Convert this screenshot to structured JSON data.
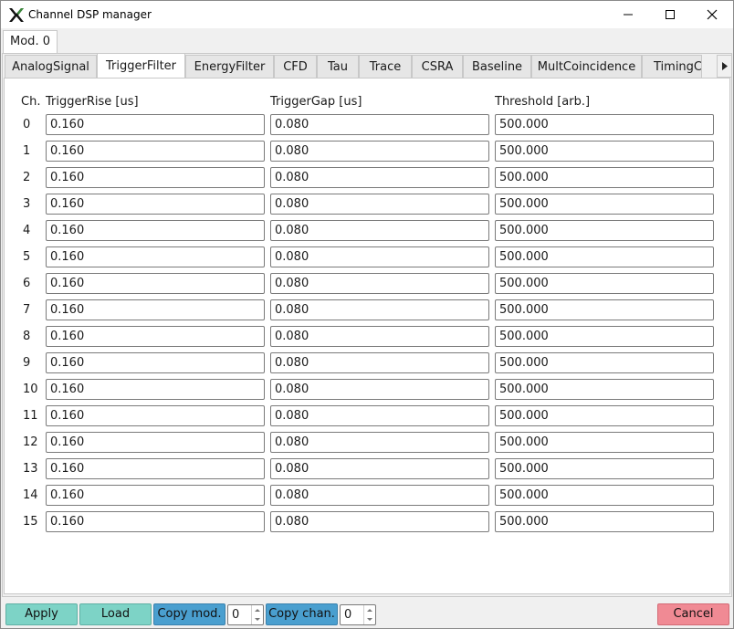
{
  "window": {
    "title": "Channel DSP manager"
  },
  "module_tab": {
    "label": "Mod. 0"
  },
  "tabs": [
    {
      "label": "AnalogSignal",
      "active": false
    },
    {
      "label": "TriggerFilter",
      "active": true
    },
    {
      "label": "EnergyFilter",
      "active": false
    },
    {
      "label": "CFD",
      "active": false
    },
    {
      "label": "Tau",
      "active": false
    },
    {
      "label": "Trace",
      "active": false
    },
    {
      "label": "CSRA",
      "active": false
    },
    {
      "label": "Baseline",
      "active": false
    },
    {
      "label": "MultCoincidence",
      "active": false
    },
    {
      "label": "TimingCo",
      "active": false
    }
  ],
  "table": {
    "headers": {
      "ch": "Ch.",
      "rise": "TriggerRise [us]",
      "gap": "TriggerGap [us]",
      "threshold": "Threshold [arb.]"
    },
    "rows": [
      {
        "ch": "0",
        "rise": "0.160",
        "gap": "0.080",
        "threshold": "500.000"
      },
      {
        "ch": "1",
        "rise": "0.160",
        "gap": "0.080",
        "threshold": "500.000"
      },
      {
        "ch": "2",
        "rise": "0.160",
        "gap": "0.080",
        "threshold": "500.000"
      },
      {
        "ch": "3",
        "rise": "0.160",
        "gap": "0.080",
        "threshold": "500.000"
      },
      {
        "ch": "4",
        "rise": "0.160",
        "gap": "0.080",
        "threshold": "500.000"
      },
      {
        "ch": "5",
        "rise": "0.160",
        "gap": "0.080",
        "threshold": "500.000"
      },
      {
        "ch": "6",
        "rise": "0.160",
        "gap": "0.080",
        "threshold": "500.000"
      },
      {
        "ch": "7",
        "rise": "0.160",
        "gap": "0.080",
        "threshold": "500.000"
      },
      {
        "ch": "8",
        "rise": "0.160",
        "gap": "0.080",
        "threshold": "500.000"
      },
      {
        "ch": "9",
        "rise": "0.160",
        "gap": "0.080",
        "threshold": "500.000"
      },
      {
        "ch": "10",
        "rise": "0.160",
        "gap": "0.080",
        "threshold": "500.000"
      },
      {
        "ch": "11",
        "rise": "0.160",
        "gap": "0.080",
        "threshold": "500.000"
      },
      {
        "ch": "12",
        "rise": "0.160",
        "gap": "0.080",
        "threshold": "500.000"
      },
      {
        "ch": "13",
        "rise": "0.160",
        "gap": "0.080",
        "threshold": "500.000"
      },
      {
        "ch": "14",
        "rise": "0.160",
        "gap": "0.080",
        "threshold": "500.000"
      },
      {
        "ch": "15",
        "rise": "0.160",
        "gap": "0.080",
        "threshold": "500.000"
      }
    ]
  },
  "footer": {
    "apply": "Apply",
    "load": "Load",
    "copy_mod": "Copy mod.",
    "copy_mod_value": "0",
    "copy_chan": "Copy chan.",
    "copy_chan_value": "0",
    "cancel": "Cancel"
  },
  "colors": {
    "action_green": "#7dd3c6",
    "action_blue": "#4a9fcf",
    "cancel_red": "#f08a94"
  },
  "icons": [
    "app-logo-icon",
    "minimize-icon",
    "maximize-icon",
    "close-icon",
    "tab-scroll-right-icon",
    "spin-up-icon",
    "spin-down-icon"
  ]
}
